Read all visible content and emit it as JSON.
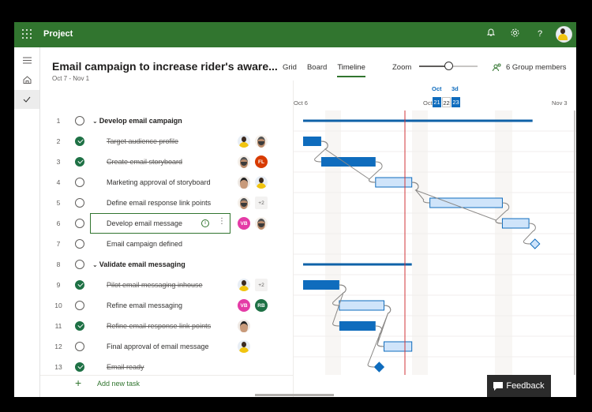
{
  "app": {
    "name": "Project"
  },
  "topbar": {
    "icons": [
      "waffle-icon",
      "bell-icon",
      "gear-icon",
      "help-icon",
      "avatar"
    ],
    "help_glyph": "?"
  },
  "leftnav": {
    "items": [
      "menu",
      "home",
      "my-tasks"
    ]
  },
  "project": {
    "title": "Email campaign to increase rider's aware...",
    "dates": "Oct 7 - Nov 1"
  },
  "views": {
    "tabs": [
      {
        "label": "Grid",
        "active": false
      },
      {
        "label": "Board",
        "active": false
      },
      {
        "label": "Timeline",
        "active": true
      }
    ]
  },
  "zoom": {
    "label": "Zoom",
    "level_percent": 50
  },
  "group_members": {
    "label": "6 Group members"
  },
  "timeline": {
    "start_label": "Oct 6",
    "end_label": "Nov 3",
    "mid_prefix": "Oct",
    "selected_month": "Oct",
    "selected_span": "3d",
    "selected_days": [
      "21",
      "22",
      "23"
    ],
    "today_day": "22",
    "colors": {
      "bar_done": "#0f6cbd",
      "bar_open": "#cfe4fa",
      "summary": "#0f62a8",
      "today_line": "#d13438",
      "link": "#8a8886"
    }
  },
  "tasks": [
    {
      "num": "1",
      "name": "Develop email campaign",
      "summary": true,
      "done": false,
      "avatars": [],
      "start": 0,
      "end": 19
    },
    {
      "num": "2",
      "name": "Target audience profile",
      "done": true,
      "avatars": [
        {
          "type": "photo-woman"
        },
        {
          "type": "photo-man"
        }
      ],
      "start": 0,
      "end": 1.5
    },
    {
      "num": "3",
      "name": "Create email storyboard",
      "done": true,
      "avatars": [
        {
          "type": "photo-man"
        },
        {
          "initials": "FL",
          "color": "#d83b01"
        }
      ],
      "start": 1.5,
      "end": 6
    },
    {
      "num": "4",
      "name": "Marketing approval of storyboard",
      "done": false,
      "avatars": [
        {
          "type": "photo-man2"
        },
        {
          "type": "photo-woman"
        }
      ],
      "start": 6,
      "end": 9
    },
    {
      "num": "5",
      "name": "Define email response link points",
      "done": false,
      "avatars": [
        {
          "type": "photo-man"
        },
        {
          "more": "+2"
        }
      ],
      "start": 10.5,
      "end": 16.5
    },
    {
      "num": "6",
      "name": "Develop email message",
      "done": false,
      "selected": true,
      "avatars": [
        {
          "initials": "VB",
          "color": "#e43ba6"
        },
        {
          "type": "photo-man"
        }
      ],
      "start": 16.5,
      "end": 18.7
    },
    {
      "num": "7",
      "name": "Email campaign defined",
      "done": false,
      "milestone": true,
      "avatars": [],
      "start": 19.2
    },
    {
      "num": "8",
      "name": "Validate email messaging",
      "summary": true,
      "done": false,
      "avatars": [],
      "start": 0,
      "end": 9
    },
    {
      "num": "9",
      "name": "Pilot email messaging inhouse",
      "done": true,
      "avatars": [
        {
          "type": "photo-woman"
        },
        {
          "more": "+2"
        }
      ],
      "start": 0,
      "end": 3
    },
    {
      "num": "10",
      "name": "Refine email messaging",
      "done": false,
      "avatars": [
        {
          "initials": "VB",
          "color": "#e43ba6"
        },
        {
          "initials": "RB",
          "color": "#1e7145"
        }
      ],
      "start": 3,
      "end": 6.7
    },
    {
      "num": "11",
      "name": "Refine email response link points",
      "done": true,
      "avatars": [
        {
          "type": "photo-man2"
        }
      ],
      "start": 3,
      "end": 6
    },
    {
      "num": "12",
      "name": "Final approval of email message",
      "done": false,
      "avatars": [
        {
          "type": "photo-woman"
        }
      ],
      "start": 6.7,
      "end": 9
    },
    {
      "num": "13",
      "name": "Email ready",
      "done": true,
      "milestone": true,
      "avatars": [],
      "start": 6.3
    }
  ],
  "add_task": {
    "label": "Add new task"
  },
  "feedback": {
    "label": "Feedback"
  }
}
